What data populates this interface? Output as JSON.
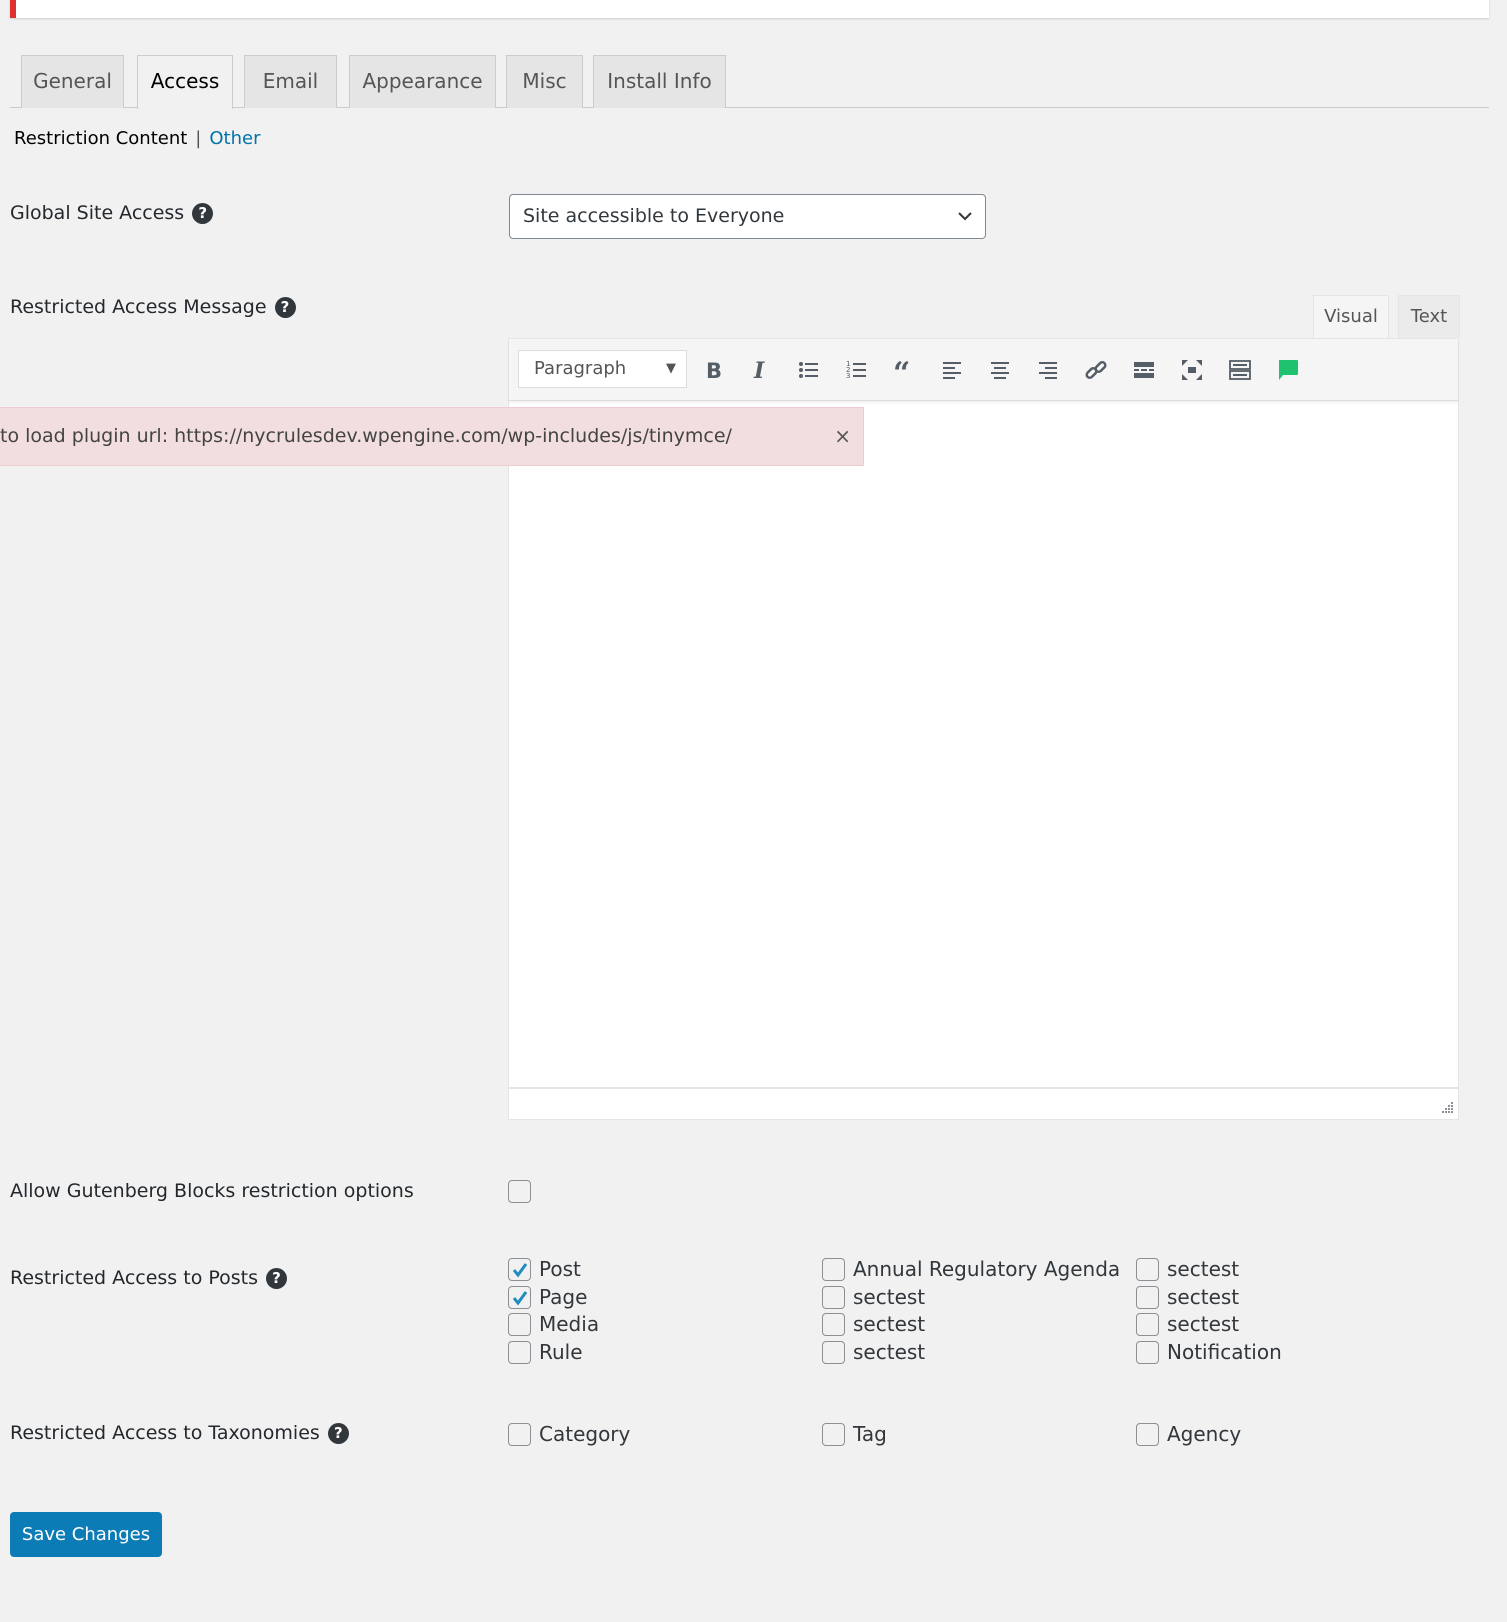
{
  "tabs": [
    {
      "label": "General",
      "active": false
    },
    {
      "label": "Access",
      "active": true
    },
    {
      "label": "Email",
      "active": false
    },
    {
      "label": "Appearance",
      "active": false
    },
    {
      "label": "Misc",
      "active": false
    },
    {
      "label": "Install Info",
      "active": false
    }
  ],
  "subnav": {
    "current": "Restriction Content",
    "separator": "|",
    "other": "Other"
  },
  "global_site_access": {
    "label": "Global Site Access",
    "help_icon": "question-circle-icon",
    "selected": "Site accessible to Everyone"
  },
  "restricted_message": {
    "label": "Restricted Access Message",
    "help_icon": "question-circle-icon",
    "editor_tabs": {
      "visual": "Visual",
      "text": "Text"
    },
    "format_select": "Paragraph",
    "toolbar_icons": [
      "bold-icon",
      "italic-icon",
      "bullet-list-icon",
      "numbered-list-icon",
      "blockquote-icon",
      "align-left-icon",
      "align-center-icon",
      "align-right-icon",
      "link-icon",
      "read-more-icon",
      "fullscreen-icon",
      "toolbar-toggle-icon",
      "comment-icon"
    ],
    "content": ""
  },
  "error_notice": {
    "text": "to load plugin url: https://nycrulesdev.wpengine.com/wp-includes/js/tinymce/",
    "close": "×"
  },
  "gutenberg": {
    "label": "Allow Gutenberg Blocks restriction options",
    "checked": false
  },
  "restricted_posts": {
    "label": "Restricted Access to Posts",
    "columns": [
      [
        {
          "label": "Post",
          "checked": true
        },
        {
          "label": "Page",
          "checked": true
        },
        {
          "label": "Media",
          "checked": false
        },
        {
          "label": "Rule",
          "checked": false
        }
      ],
      [
        {
          "label": "Annual Regulatory Agenda",
          "checked": false
        },
        {
          "label": "sectest",
          "checked": false
        },
        {
          "label": "sectest",
          "checked": false
        },
        {
          "label": "sectest",
          "checked": false
        }
      ],
      [
        {
          "label": "sectest",
          "checked": false
        },
        {
          "label": "sectest",
          "checked": false
        },
        {
          "label": "sectest",
          "checked": false
        },
        {
          "label": "Notification",
          "checked": false
        }
      ]
    ]
  },
  "restricted_taxonomies": {
    "label": "Restricted Access to Taxonomies",
    "items": [
      {
        "label": "Category",
        "checked": false
      },
      {
        "label": "Tag",
        "checked": false
      },
      {
        "label": "Agency",
        "checked": false
      }
    ]
  },
  "save_button": "Save Changes",
  "colors": {
    "accent": "#0b7cb6",
    "link": "#0073aa",
    "error_bg": "#f2dede",
    "notice_border": "#dc3232",
    "check": "#1e8cbe",
    "comment_green": "#1fc26e"
  }
}
